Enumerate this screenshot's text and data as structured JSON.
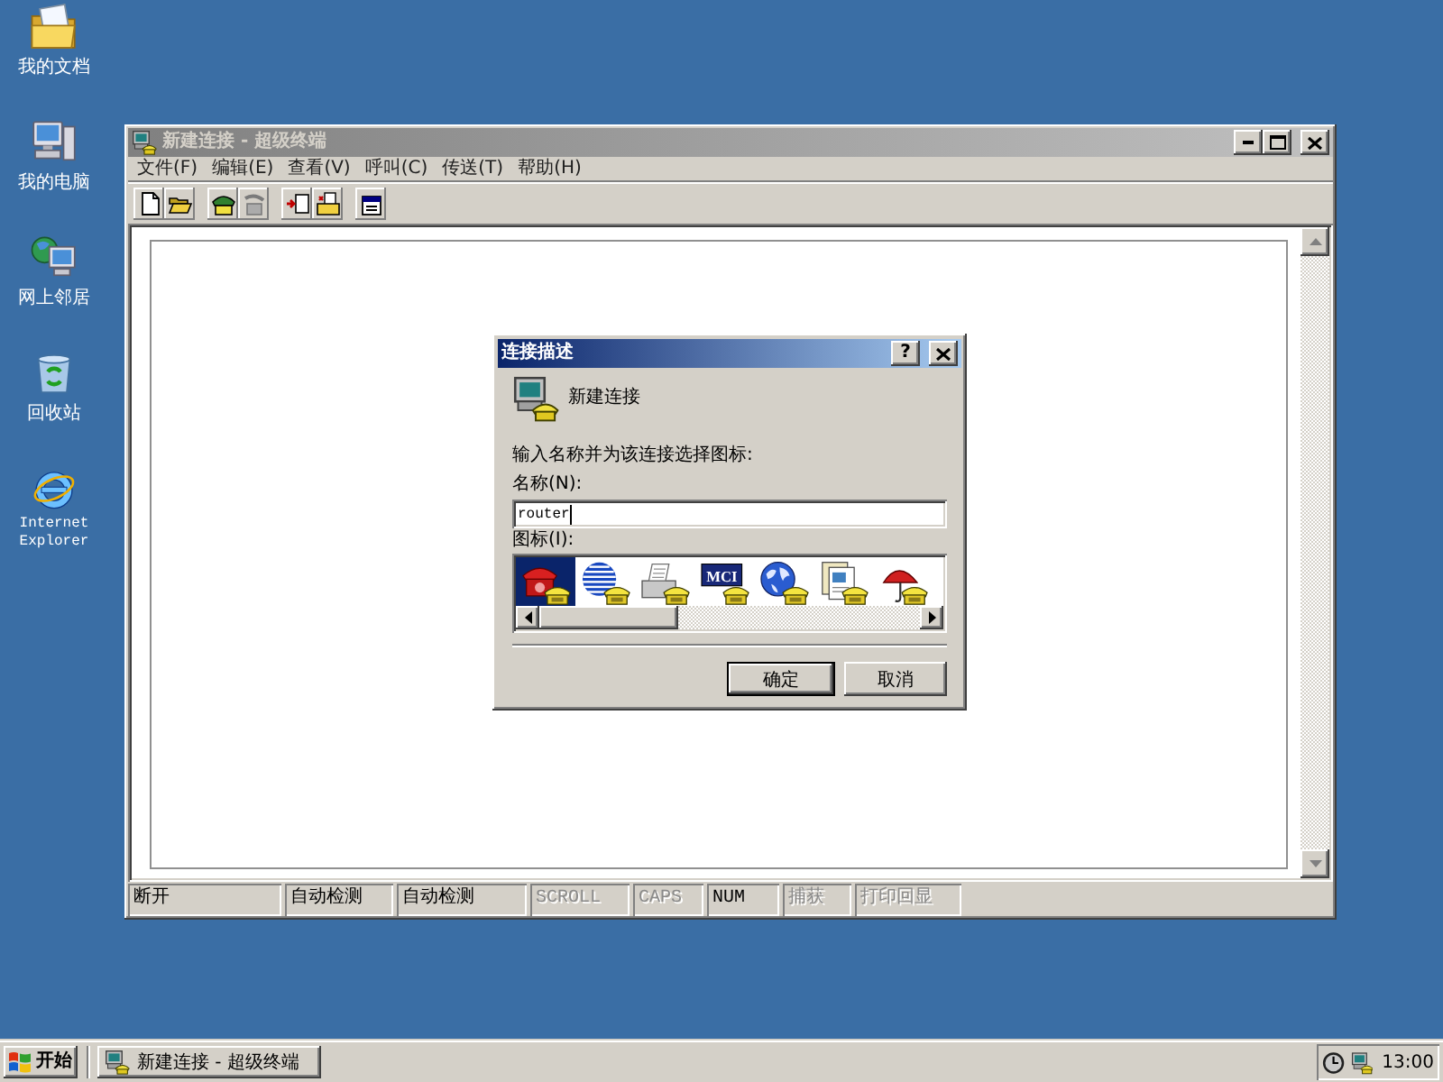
{
  "desktop_icons": [
    {
      "kind": "documents",
      "label": "我的文档"
    },
    {
      "kind": "computer",
      "label": "我的电脑"
    },
    {
      "kind": "network",
      "label": "网上邻居"
    },
    {
      "kind": "recycle-bin",
      "label": "回收站"
    },
    {
      "kind": "browser",
      "label": "Internet Explorer"
    }
  ],
  "window": {
    "title": "新建连接 - 超级终端",
    "active": false,
    "menu": [
      "文件(F)",
      "编辑(E)",
      "查看(V)",
      "呼叫(C)",
      "传送(T)",
      "帮助(H)"
    ],
    "toolbar": [
      [
        {
          "kind": "new",
          "disabled": false
        },
        {
          "kind": "open",
          "disabled": false
        }
      ],
      [
        {
          "kind": "call",
          "disabled": false
        },
        {
          "kind": "disconnect",
          "disabled": true
        }
      ],
      [
        {
          "kind": "send",
          "disabled": false
        },
        {
          "kind": "receive",
          "disabled": false
        }
      ],
      [
        {
          "kind": "properties",
          "disabled": false
        }
      ]
    ],
    "status_bar": [
      {
        "text": "断开",
        "disabled": false
      },
      {
        "text": "自动检测",
        "disabled": false
      },
      {
        "text": "自动检测",
        "disabled": false
      },
      {
        "text": "SCROLL",
        "disabled": true
      },
      {
        "text": "CAPS",
        "disabled": true
      },
      {
        "text": "NUM",
        "disabled": false
      },
      {
        "text": "捕获",
        "disabled": true
      },
      {
        "text": "打印回显",
        "disabled": true
      }
    ]
  },
  "dialog": {
    "title": "连接描述",
    "active": true,
    "help": "?",
    "heading": "新建连接",
    "prompt": "输入名称并为该连接选择图标:",
    "name_label": "名称(N):",
    "name_value": "router",
    "icon_label": "图标(I):",
    "icons": [
      {
        "kind": "phone",
        "selected": true
      },
      {
        "kind": "striped-globe",
        "selected": false
      },
      {
        "kind": "fax",
        "selected": false
      },
      {
        "kind": "mci",
        "label": "MCI",
        "selected": false
      },
      {
        "kind": "globe",
        "selected": false
      },
      {
        "kind": "document",
        "selected": false
      },
      {
        "kind": "umbrella",
        "selected": false
      }
    ],
    "buttons": [
      {
        "label": "确定",
        "default": true
      },
      {
        "label": "取消",
        "default": false
      }
    ]
  },
  "taskbar": {
    "start": "开始",
    "tasks": [
      {
        "label": "新建连接 - 超级终端",
        "selected": false
      }
    ],
    "clock": "13:00"
  }
}
